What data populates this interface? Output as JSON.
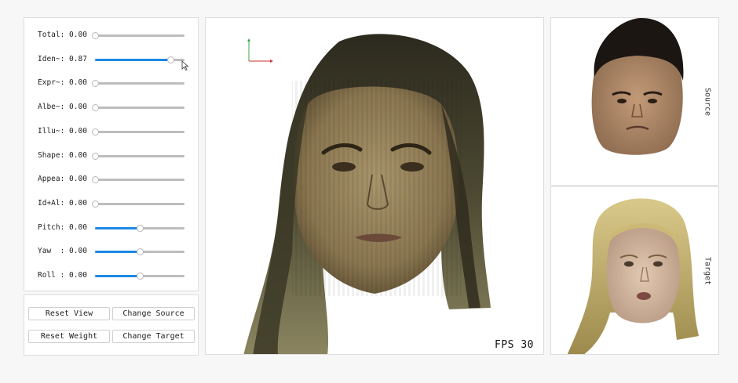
{
  "controls": {
    "sliders": [
      {
        "label": "Total:",
        "value_text": "0.00",
        "fill": 0.0
      },
      {
        "label": "Iden~:",
        "value_text": "0.87",
        "fill": 0.84
      },
      {
        "label": "Expr~:",
        "value_text": "0.00",
        "fill": 0.0
      },
      {
        "label": "Albe~:",
        "value_text": "0.00",
        "fill": 0.0
      },
      {
        "label": "Illu~:",
        "value_text": "0.00",
        "fill": 0.0
      },
      {
        "label": "Shape:",
        "value_text": "0.00",
        "fill": 0.0
      },
      {
        "label": "Appea:",
        "value_text": "0.00",
        "fill": 0.0
      },
      {
        "label": "Id+Al:",
        "value_text": "0.00",
        "fill": 0.0
      },
      {
        "label": "Pitch:",
        "value_text": "0.00",
        "fill": 0.5
      },
      {
        "label": "Yaw  :",
        "value_text": "0.00",
        "fill": 0.5
      },
      {
        "label": "Roll :",
        "value_text": "0.00",
        "fill": 0.5
      }
    ]
  },
  "buttons": {
    "reset_view": "Reset View",
    "change_source": "Change Source",
    "reset_weight": "Reset Weight",
    "change_target": "Change Target"
  },
  "viewer": {
    "fps_label": "FPS 30"
  },
  "side_panels": {
    "source_label": "Source",
    "target_label": "Target"
  },
  "colors": {
    "slider_fill": "#1e88e5",
    "slider_track": "#bdbdbd",
    "axis_x": "#d32f2f",
    "axis_y": "#43a047"
  }
}
